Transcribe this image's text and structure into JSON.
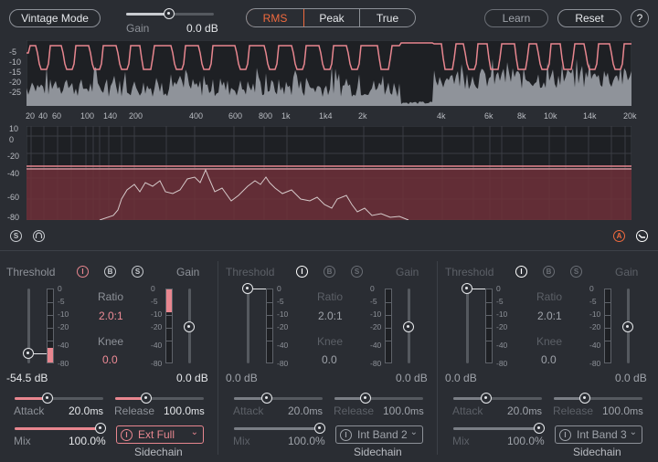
{
  "header": {
    "vintage_label": "Vintage Mode",
    "gain_label": "Gain",
    "gain_value": "0.0 dB",
    "detection_modes": [
      "RMS",
      "Peak",
      "True"
    ],
    "active_mode": "RMS",
    "learn_label": "Learn",
    "reset_label": "Reset",
    "help_label": "?"
  },
  "spectrum": {
    "level_scale": [
      "-5",
      "-10",
      "-15",
      "-20",
      "-25"
    ],
    "freq_labels": [
      "20",
      "40",
      "60",
      "100",
      "140",
      "200",
      "400",
      "600",
      "800",
      "1k",
      "1k4",
      "2k",
      "4k",
      "6k",
      "8k",
      "10k",
      "14k",
      "20k"
    ],
    "db_scale": [
      "10",
      "0",
      "-20",
      "-40",
      "-60",
      "-80"
    ],
    "solo_label": "S",
    "listen_label": "A"
  },
  "bands": [
    {
      "threshold_label": "Threshold",
      "threshold_value": "-54.5",
      "threshold_unit": "dB",
      "ratio_label": "Ratio",
      "ratio_value": "2.0:1",
      "knee_label": "Knee",
      "knee_value": "0.0",
      "gain_label": "Gain",
      "gain_value": "0.0 dB",
      "attack_label": "Attack",
      "attack_value": "20.0",
      "attack_unit": "ms",
      "release_label": "Release",
      "release_value": "100.0",
      "release_unit": "ms",
      "mix_label": "Mix",
      "mix_value": "100.0%",
      "sidechain_value": "Ext Full",
      "sidechain_label": "Sidechain",
      "meter_scale": [
        "0",
        "-5",
        "-10",
        "-20",
        "-40",
        "-80"
      ],
      "enable_icon": "I",
      "bypass_icon": "B",
      "solo_icon": "S",
      "active": true
    },
    {
      "threshold_label": "Threshold",
      "threshold_value": "0.0",
      "threshold_unit": "dB",
      "ratio_label": "Ratio",
      "ratio_value": "2.0:1",
      "knee_label": "Knee",
      "knee_value": "0.0",
      "gain_label": "Gain",
      "gain_value": "0.0 dB",
      "attack_label": "Attack",
      "attack_value": "20.0",
      "attack_unit": "ms",
      "release_label": "Release",
      "release_value": "100.0",
      "release_unit": "ms",
      "mix_label": "Mix",
      "mix_value": "100.0%",
      "sidechain_value": "Int Band 2",
      "sidechain_label": "Sidechain",
      "meter_scale": [
        "0",
        "-5",
        "-10",
        "-20",
        "-40",
        "-80"
      ],
      "enable_icon": "I",
      "bypass_icon": "B",
      "solo_icon": "S",
      "active": false
    },
    {
      "threshold_label": "Threshold",
      "threshold_value": "0.0",
      "threshold_unit": "dB",
      "ratio_label": "Ratio",
      "ratio_value": "2.0:1",
      "knee_label": "Knee",
      "knee_value": "0.0",
      "gain_label": "Gain",
      "gain_value": "0.0 dB",
      "attack_label": "Attack",
      "attack_value": "20.0",
      "attack_unit": "ms",
      "release_label": "Release",
      "release_value": "100.0",
      "release_unit": "ms",
      "mix_label": "Mix",
      "mix_value": "100.0%",
      "sidechain_value": "Int Band 3",
      "sidechain_label": "Sidechain",
      "meter_scale": [
        "0",
        "-5",
        "-10",
        "-20",
        "-40",
        "-80"
      ],
      "enable_icon": "I",
      "bypass_icon": "B",
      "solo_icon": "S",
      "active": false
    }
  ],
  "colors": {
    "accent": "#f06a3e",
    "curve": "#e8868f",
    "background": "#2a2d33",
    "graph_bg": "#1e2024"
  }
}
